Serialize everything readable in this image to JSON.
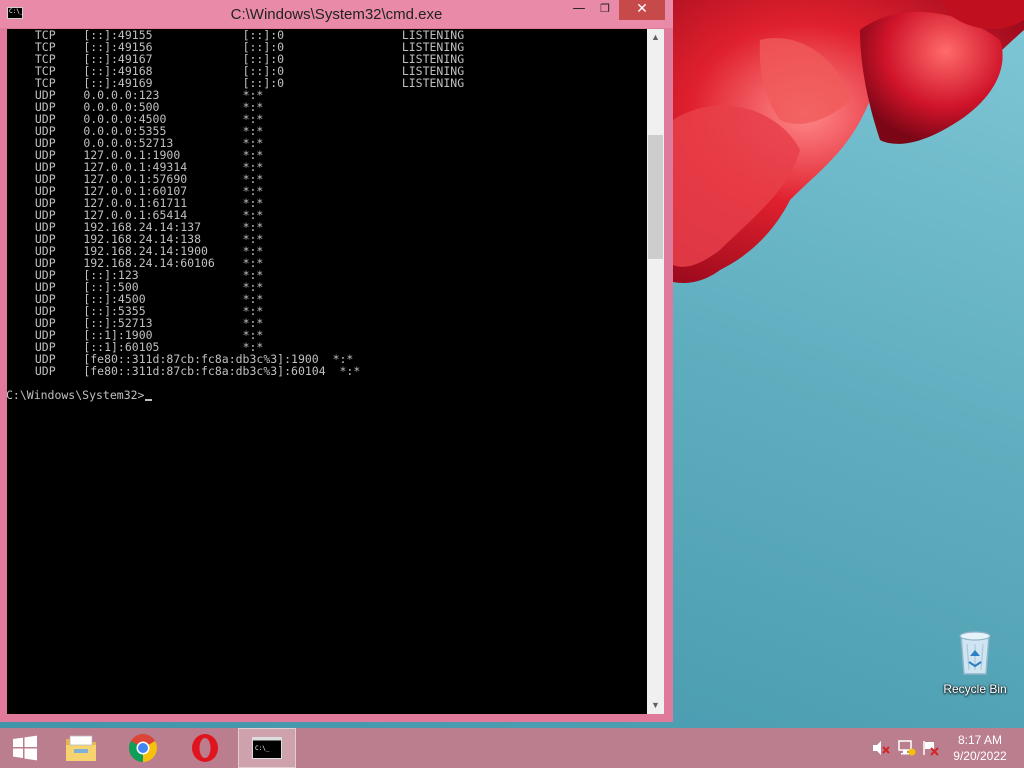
{
  "window": {
    "title": "C:\\Windows\\System32\\cmd.exe",
    "minimize_glyph": "—",
    "maximize_glyph": "❐",
    "close_glyph": "✕",
    "icon": "cmd-app-icon",
    "icon_text": "C:\\_"
  },
  "console": {
    "lines": [
      {
        "proto": "TCP",
        "local": "[::]:49155",
        "foreign": "[::]:0",
        "state": "LISTENING"
      },
      {
        "proto": "TCP",
        "local": "[::]:49156",
        "foreign": "[::]:0",
        "state": "LISTENING"
      },
      {
        "proto": "TCP",
        "local": "[::]:49167",
        "foreign": "[::]:0",
        "state": "LISTENING"
      },
      {
        "proto": "TCP",
        "local": "[::]:49168",
        "foreign": "[::]:0",
        "state": "LISTENING"
      },
      {
        "proto": "TCP",
        "local": "[::]:49169",
        "foreign": "[::]:0",
        "state": "LISTENING"
      },
      {
        "proto": "UDP",
        "local": "0.0.0.0:123",
        "foreign": "*:*",
        "state": ""
      },
      {
        "proto": "UDP",
        "local": "0.0.0.0:500",
        "foreign": "*:*",
        "state": ""
      },
      {
        "proto": "UDP",
        "local": "0.0.0.0:4500",
        "foreign": "*:*",
        "state": ""
      },
      {
        "proto": "UDP",
        "local": "0.0.0.0:5355",
        "foreign": "*:*",
        "state": ""
      },
      {
        "proto": "UDP",
        "local": "0.0.0.0:52713",
        "foreign": "*:*",
        "state": ""
      },
      {
        "proto": "UDP",
        "local": "127.0.0.1:1900",
        "foreign": "*:*",
        "state": ""
      },
      {
        "proto": "UDP",
        "local": "127.0.0.1:49314",
        "foreign": "*:*",
        "state": ""
      },
      {
        "proto": "UDP",
        "local": "127.0.0.1:57690",
        "foreign": "*:*",
        "state": ""
      },
      {
        "proto": "UDP",
        "local": "127.0.0.1:60107",
        "foreign": "*:*",
        "state": ""
      },
      {
        "proto": "UDP",
        "local": "127.0.0.1:61711",
        "foreign": "*:*",
        "state": ""
      },
      {
        "proto": "UDP",
        "local": "127.0.0.1:65414",
        "foreign": "*:*",
        "state": ""
      },
      {
        "proto": "UDP",
        "local": "192.168.24.14:137",
        "foreign": "*:*",
        "state": ""
      },
      {
        "proto": "UDP",
        "local": "192.168.24.14:138",
        "foreign": "*:*",
        "state": ""
      },
      {
        "proto": "UDP",
        "local": "192.168.24.14:1900",
        "foreign": "*:*",
        "state": ""
      },
      {
        "proto": "UDP",
        "local": "192.168.24.14:60106",
        "foreign": "*:*",
        "state": ""
      },
      {
        "proto": "UDP",
        "local": "[::]:123",
        "foreign": "*:*",
        "state": ""
      },
      {
        "proto": "UDP",
        "local": "[::]:500",
        "foreign": "*:*",
        "state": ""
      },
      {
        "proto": "UDP",
        "local": "[::]:4500",
        "foreign": "*:*",
        "state": ""
      },
      {
        "proto": "UDP",
        "local": "[::]:5355",
        "foreign": "*:*",
        "state": ""
      },
      {
        "proto": "UDP",
        "local": "[::]:52713",
        "foreign": "*:*",
        "state": ""
      },
      {
        "proto": "UDP",
        "local": "[::1]:1900",
        "foreign": "*:*",
        "state": ""
      },
      {
        "proto": "UDP",
        "local": "[::1]:60105",
        "foreign": "*:*",
        "state": ""
      },
      {
        "proto": "UDP",
        "local": "[fe80::311d:87cb:fc8a:db3c%3]:1900",
        "foreign": "*:*",
        "state": ""
      },
      {
        "proto": "UDP",
        "local": "[fe80::311d:87cb:fc8a:db3c%3]:60104",
        "foreign": "*:*",
        "state": ""
      }
    ],
    "prompt": "C:\\Windows\\System32>"
  },
  "scrollbar": {
    "up_glyph": "▲",
    "down_glyph": "▼",
    "position_fraction": 0.17
  },
  "desktop": {
    "recycle_bin_label": "Recycle Bin",
    "recycle_bin_icon": "recycle-bin-icon"
  },
  "taskbar": {
    "items": [
      "start-windows-logo-icon",
      "file-explorer-icon",
      "chrome-icon",
      "opera-icon",
      "command-prompt-icon"
    ],
    "active_item": "command-prompt-icon",
    "cmd_icon_text": "C:\\_"
  },
  "tray": {
    "icons": [
      "volume-muted-icon",
      "network-icon",
      "action-center-flag-icon"
    ],
    "time": "8:17 AM",
    "date": "9/20/2022"
  },
  "colors": {
    "window_frame": "#e07a9b",
    "console_bg": "#000000",
    "console_text": "#c0c0c0",
    "close_button": "#c74a4a",
    "taskbar": "#ba7e8e",
    "desktop_bg": "#5faebf",
    "flower": "#d4142a"
  }
}
